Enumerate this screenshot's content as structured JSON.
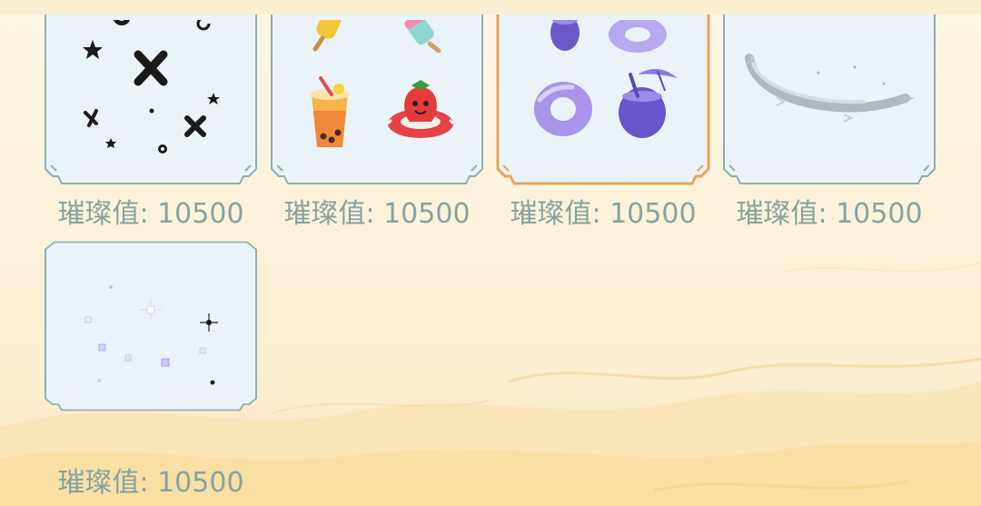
{
  "colors": {
    "card_fill": "#eaf4f8",
    "card_border": "#8eaeb4",
    "selected_border": "#e6a35a",
    "value_text": "#86a2a2",
    "background": "#fcf1d8"
  },
  "items": [
    {
      "name": "black-stars-effect",
      "value_label": "璀璨值: 10500",
      "selected": false
    },
    {
      "name": "summer-drinks-effect",
      "value_label": "璀璨值: 10500",
      "selected": false
    },
    {
      "name": "purple-swim-ring-effect",
      "value_label": "璀璨值: 10500",
      "selected": true
    },
    {
      "name": "silver-comet-effect",
      "value_label": "璀璨值: 10500",
      "selected": false
    },
    {
      "name": "sparkle-stars-effect",
      "value_label": "璀璨值: 10500",
      "selected": false
    }
  ]
}
